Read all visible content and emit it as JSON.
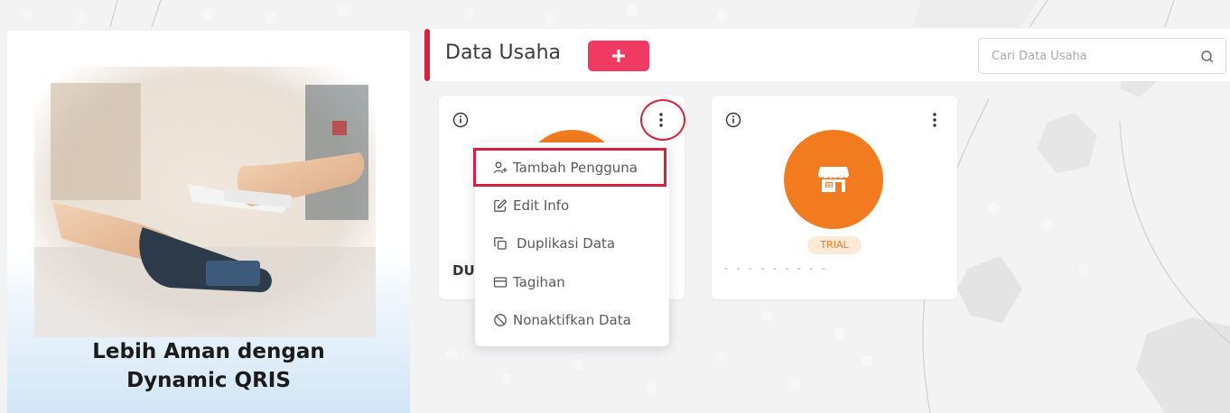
{
  "promo": {
    "title_line1": "Lebih Aman dengan",
    "title_line2": "Dynamic QRIS"
  },
  "header": {
    "title": "Data Usaha",
    "add_button_icon": "plus-icon",
    "accent_color": "#d7213d",
    "add_button_color": "#ef3a62"
  },
  "search": {
    "placeholder": "Cari Data Usaha",
    "icon": "search-icon"
  },
  "cards": [
    {
      "name_partial": "DU",
      "icons": [
        "info-icon",
        "kebab-menu-icon"
      ]
    },
    {
      "badge": "TRIAL",
      "subtitle": "- -         - - - - - - -",
      "icons": [
        "info-icon",
        "kebab-menu-icon",
        "store-icon"
      ]
    }
  ],
  "menu": {
    "items": [
      {
        "label": "Tambah Pengguna",
        "icon": "add-user-icon"
      },
      {
        "label": "Edit Info",
        "icon": "edit-icon"
      },
      {
        "label": "Duplikasi Data",
        "icon": "copy-icon"
      },
      {
        "label": "Tagihan",
        "icon": "billing-card-icon"
      },
      {
        "label": "Nonaktifkan Data",
        "icon": "block-icon"
      }
    ]
  },
  "colors": {
    "brand_orange": "#f27b20",
    "badge_bg": "#fdebd8",
    "highlight_red": "#d7213d"
  }
}
